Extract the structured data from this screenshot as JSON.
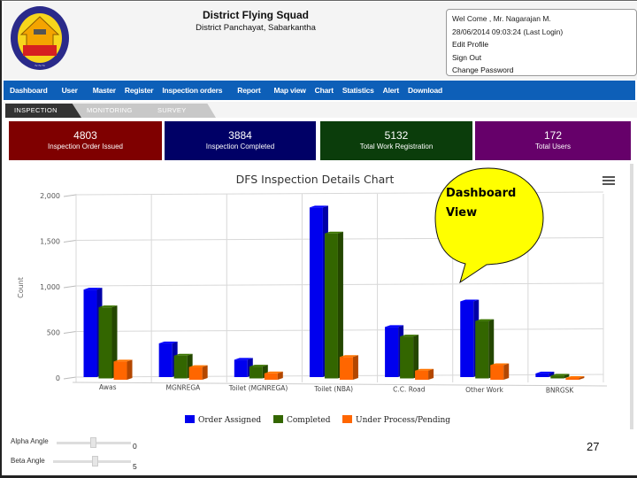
{
  "header": {
    "title": "District Flying Squad",
    "subtitle": "District Panchayat, Sabarkantha",
    "logo": "district-panchayat-emblem"
  },
  "user_panel": {
    "welcome": "Wel Come , Mr. Nagarajan M.",
    "last_login": "28/06/2014 09:03:24 (Last Login)",
    "links": [
      "Edit Profile",
      "Sign Out",
      "Change Password"
    ]
  },
  "nav": {
    "items": [
      "Dashboard",
      "User",
      "Master",
      "Register",
      "Inspection orders",
      "Report",
      "Map view",
      "Chart",
      "Statistics",
      "Alert",
      "Download"
    ]
  },
  "subtabs": [
    {
      "label": "INSPECTION",
      "active": true
    },
    {
      "label": "MONITORING",
      "active": false
    },
    {
      "label": "SURVEY",
      "active": false
    }
  ],
  "stats": [
    {
      "value": "4803",
      "label": "Inspection Order Issued",
      "color": "#7f0000"
    },
    {
      "value": "3884",
      "label": "Inspection Completed",
      "color": "#000066"
    },
    {
      "value": "5132",
      "label": "Total Work Registration",
      "color": "#0b3d0b"
    },
    {
      "value": "172",
      "label": "Total Users",
      "color": "#66006a"
    }
  ],
  "callout": {
    "line1": "Dashboard",
    "line2": "View"
  },
  "chart_data": {
    "type": "bar",
    "title": "DFS Inspection Details Chart",
    "xlabel": "",
    "ylabel": "Count",
    "ylim": [
      0,
      2000
    ],
    "yticks": [
      0,
      500,
      1000,
      1500,
      2000
    ],
    "grid": true,
    "legend": "bottom",
    "three_d": true,
    "categories": [
      "Awas",
      "MGNREGA",
      "Toilet (MGNREGA)",
      "Toilet (NBA)",
      "C.C. Road",
      "Other Work",
      "BNRGSK"
    ],
    "series": [
      {
        "name": "Order Assigned",
        "color": "#0000ee",
        "values": [
          960,
          370,
          190,
          1860,
          550,
          830,
          40
        ]
      },
      {
        "name": "Completed",
        "color": "#336600",
        "values": [
          780,
          250,
          130,
          1590,
          460,
          630,
          30
        ]
      },
      {
        "name": "Under Process/Pending",
        "color": "#ff6600",
        "values": [
          200,
          140,
          70,
          250,
          100,
          160,
          20
        ]
      }
    ]
  },
  "controls": {
    "alpha": {
      "label": "Alpha Angle",
      "value": "0",
      "fraction": 0.5
    },
    "beta": {
      "label": "Beta Angle",
      "value": "5",
      "fraction": 0.55
    }
  },
  "page_number": "27"
}
